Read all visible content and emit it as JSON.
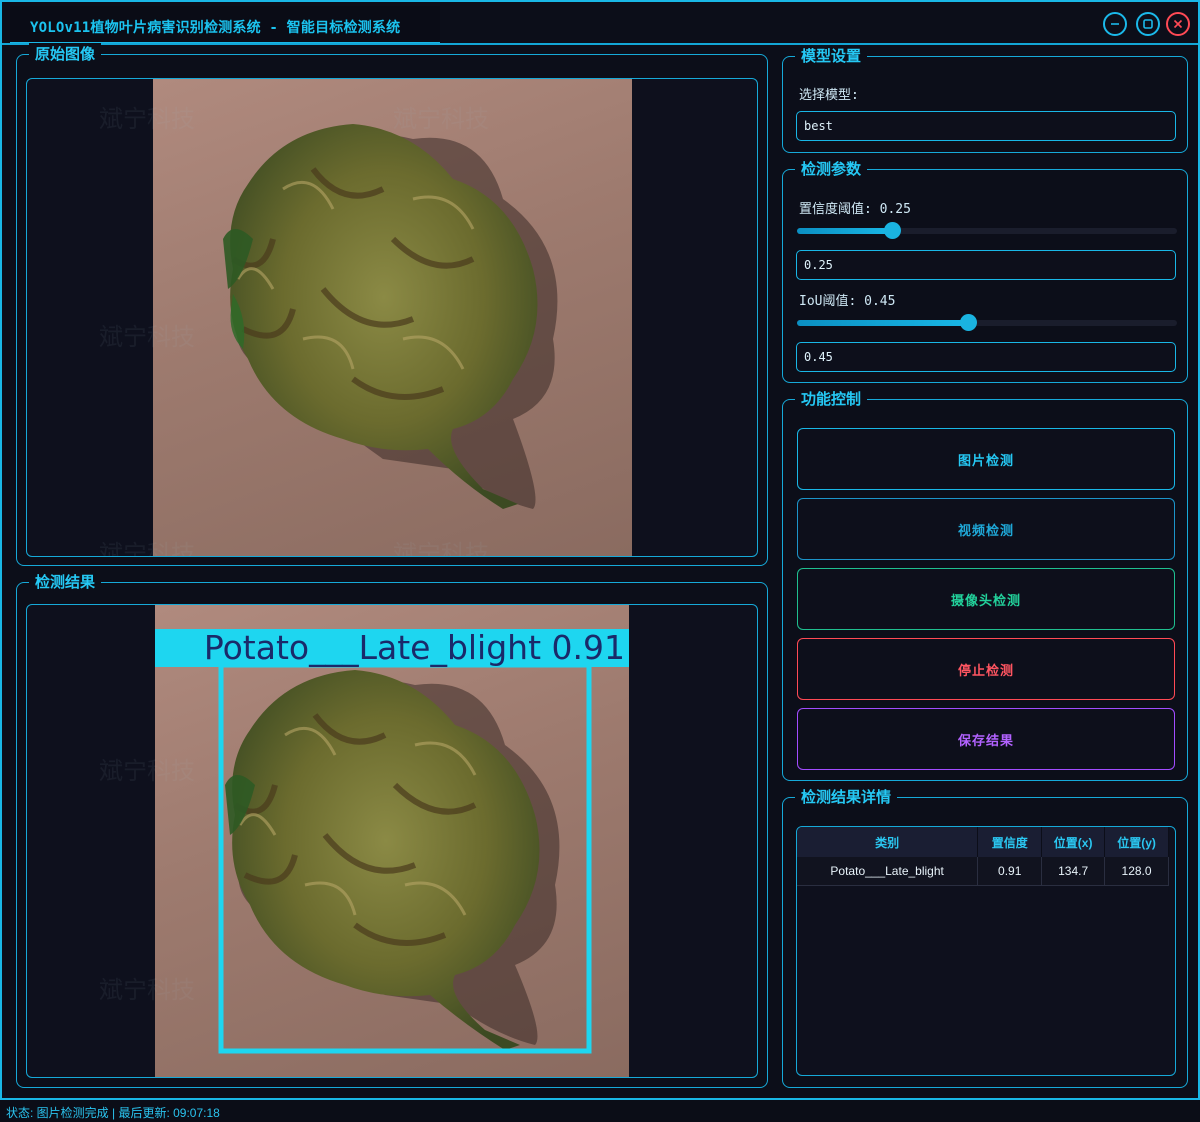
{
  "window": {
    "title": "YOLOv11植物叶片病害识别检测系统 - 智能目标检测系统"
  },
  "watermark": "斌宁科技",
  "panels": {
    "original": {
      "title": "原始图像"
    },
    "result": {
      "title": "检测结果",
      "detection_label": "Potato___Late_blight 0.91"
    }
  },
  "model_settings": {
    "title": "模型设置",
    "select_label": "选择模型:",
    "selected_model": "best"
  },
  "params": {
    "title": "检测参数",
    "conf_label": "置信度阈值: 0.25",
    "conf_value": "0.25",
    "conf_level": 0.25,
    "iou_label": "IoU阈值: 0.45",
    "iou_value": "0.45",
    "iou_level": 0.45
  },
  "controls": {
    "title": "功能控制",
    "image_btn": "图片检测",
    "video_btn": "视频检测",
    "camera_btn": "摄像头检测",
    "stop_btn": "停止检测",
    "save_btn": "保存结果"
  },
  "details": {
    "title": "检测结果详情",
    "columns": [
      "类别",
      "置信度",
      "位置(x)",
      "位置(y)"
    ],
    "rows": [
      {
        "class": "Potato___Late_blight",
        "confidence": "0.91",
        "x": "134.7",
        "y": "128.0"
      }
    ]
  },
  "status": {
    "text": "状态: 图片检测完成 | 最后更新: 09:07:18"
  },
  "colors": {
    "accent": "#19b7e6",
    "image_btn": "#19b7e6",
    "video_btn": "#1c94c9",
    "camera_btn": "#1fbf8f",
    "stop_btn": "#ff4a55",
    "save_btn": "#a24cff",
    "box": "#1ed6f0"
  },
  "icons": {
    "minimize": "minimize-icon",
    "maximize": "maximize-icon",
    "close": "close-icon"
  }
}
